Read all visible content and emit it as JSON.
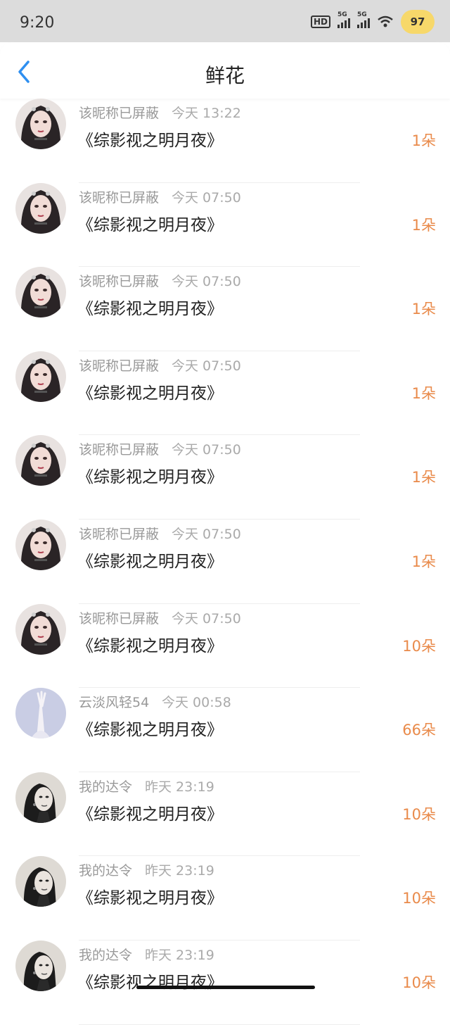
{
  "status": {
    "time": "9:20",
    "battery": "97"
  },
  "nav": {
    "title": "鲜花"
  },
  "items": [
    {
      "nick": "该昵称已屏蔽",
      "time": "今天 13:22",
      "book": "《综影视之明月夜》",
      "count": "1朵",
      "avatar": "dark-girl"
    },
    {
      "nick": "该昵称已屏蔽",
      "time": "今天 07:50",
      "book": "《综影视之明月夜》",
      "count": "1朵",
      "avatar": "dark-girl"
    },
    {
      "nick": "该昵称已屏蔽",
      "time": "今天 07:50",
      "book": "《综影视之明月夜》",
      "count": "1朵",
      "avatar": "dark-girl"
    },
    {
      "nick": "该昵称已屏蔽",
      "time": "今天 07:50",
      "book": "《综影视之明月夜》",
      "count": "1朵",
      "avatar": "dark-girl"
    },
    {
      "nick": "该昵称已屏蔽",
      "time": "今天 07:50",
      "book": "《综影视之明月夜》",
      "count": "1朵",
      "avatar": "dark-girl"
    },
    {
      "nick": "该昵称已屏蔽",
      "time": "今天 07:50",
      "book": "《综影视之明月夜》",
      "count": "1朵",
      "avatar": "dark-girl"
    },
    {
      "nick": "该昵称已屏蔽",
      "time": "今天 07:50",
      "book": "《综影视之明月夜》",
      "count": "10朵",
      "avatar": "dark-girl"
    },
    {
      "nick": "云淡风轻54",
      "time": "今天 00:58",
      "book": "《综影视之明月夜》",
      "count": "66朵",
      "avatar": "pale-hand"
    },
    {
      "nick": "我的达令",
      "time": "昨天 23:19",
      "book": "《综影视之明月夜》",
      "count": "10朵",
      "avatar": "bw-woman"
    },
    {
      "nick": "我的达令",
      "time": "昨天 23:19",
      "book": "《综影视之明月夜》",
      "count": "10朵",
      "avatar": "bw-woman"
    },
    {
      "nick": "我的达令",
      "time": "昨天 23:19",
      "book": "《综影视之明月夜》",
      "count": "10朵",
      "avatar": "bw-woman"
    }
  ],
  "colors": {
    "accent": "#e98a4a",
    "back_arrow": "#2e8ff0",
    "statusbar_bg": "#dcdcdc"
  }
}
